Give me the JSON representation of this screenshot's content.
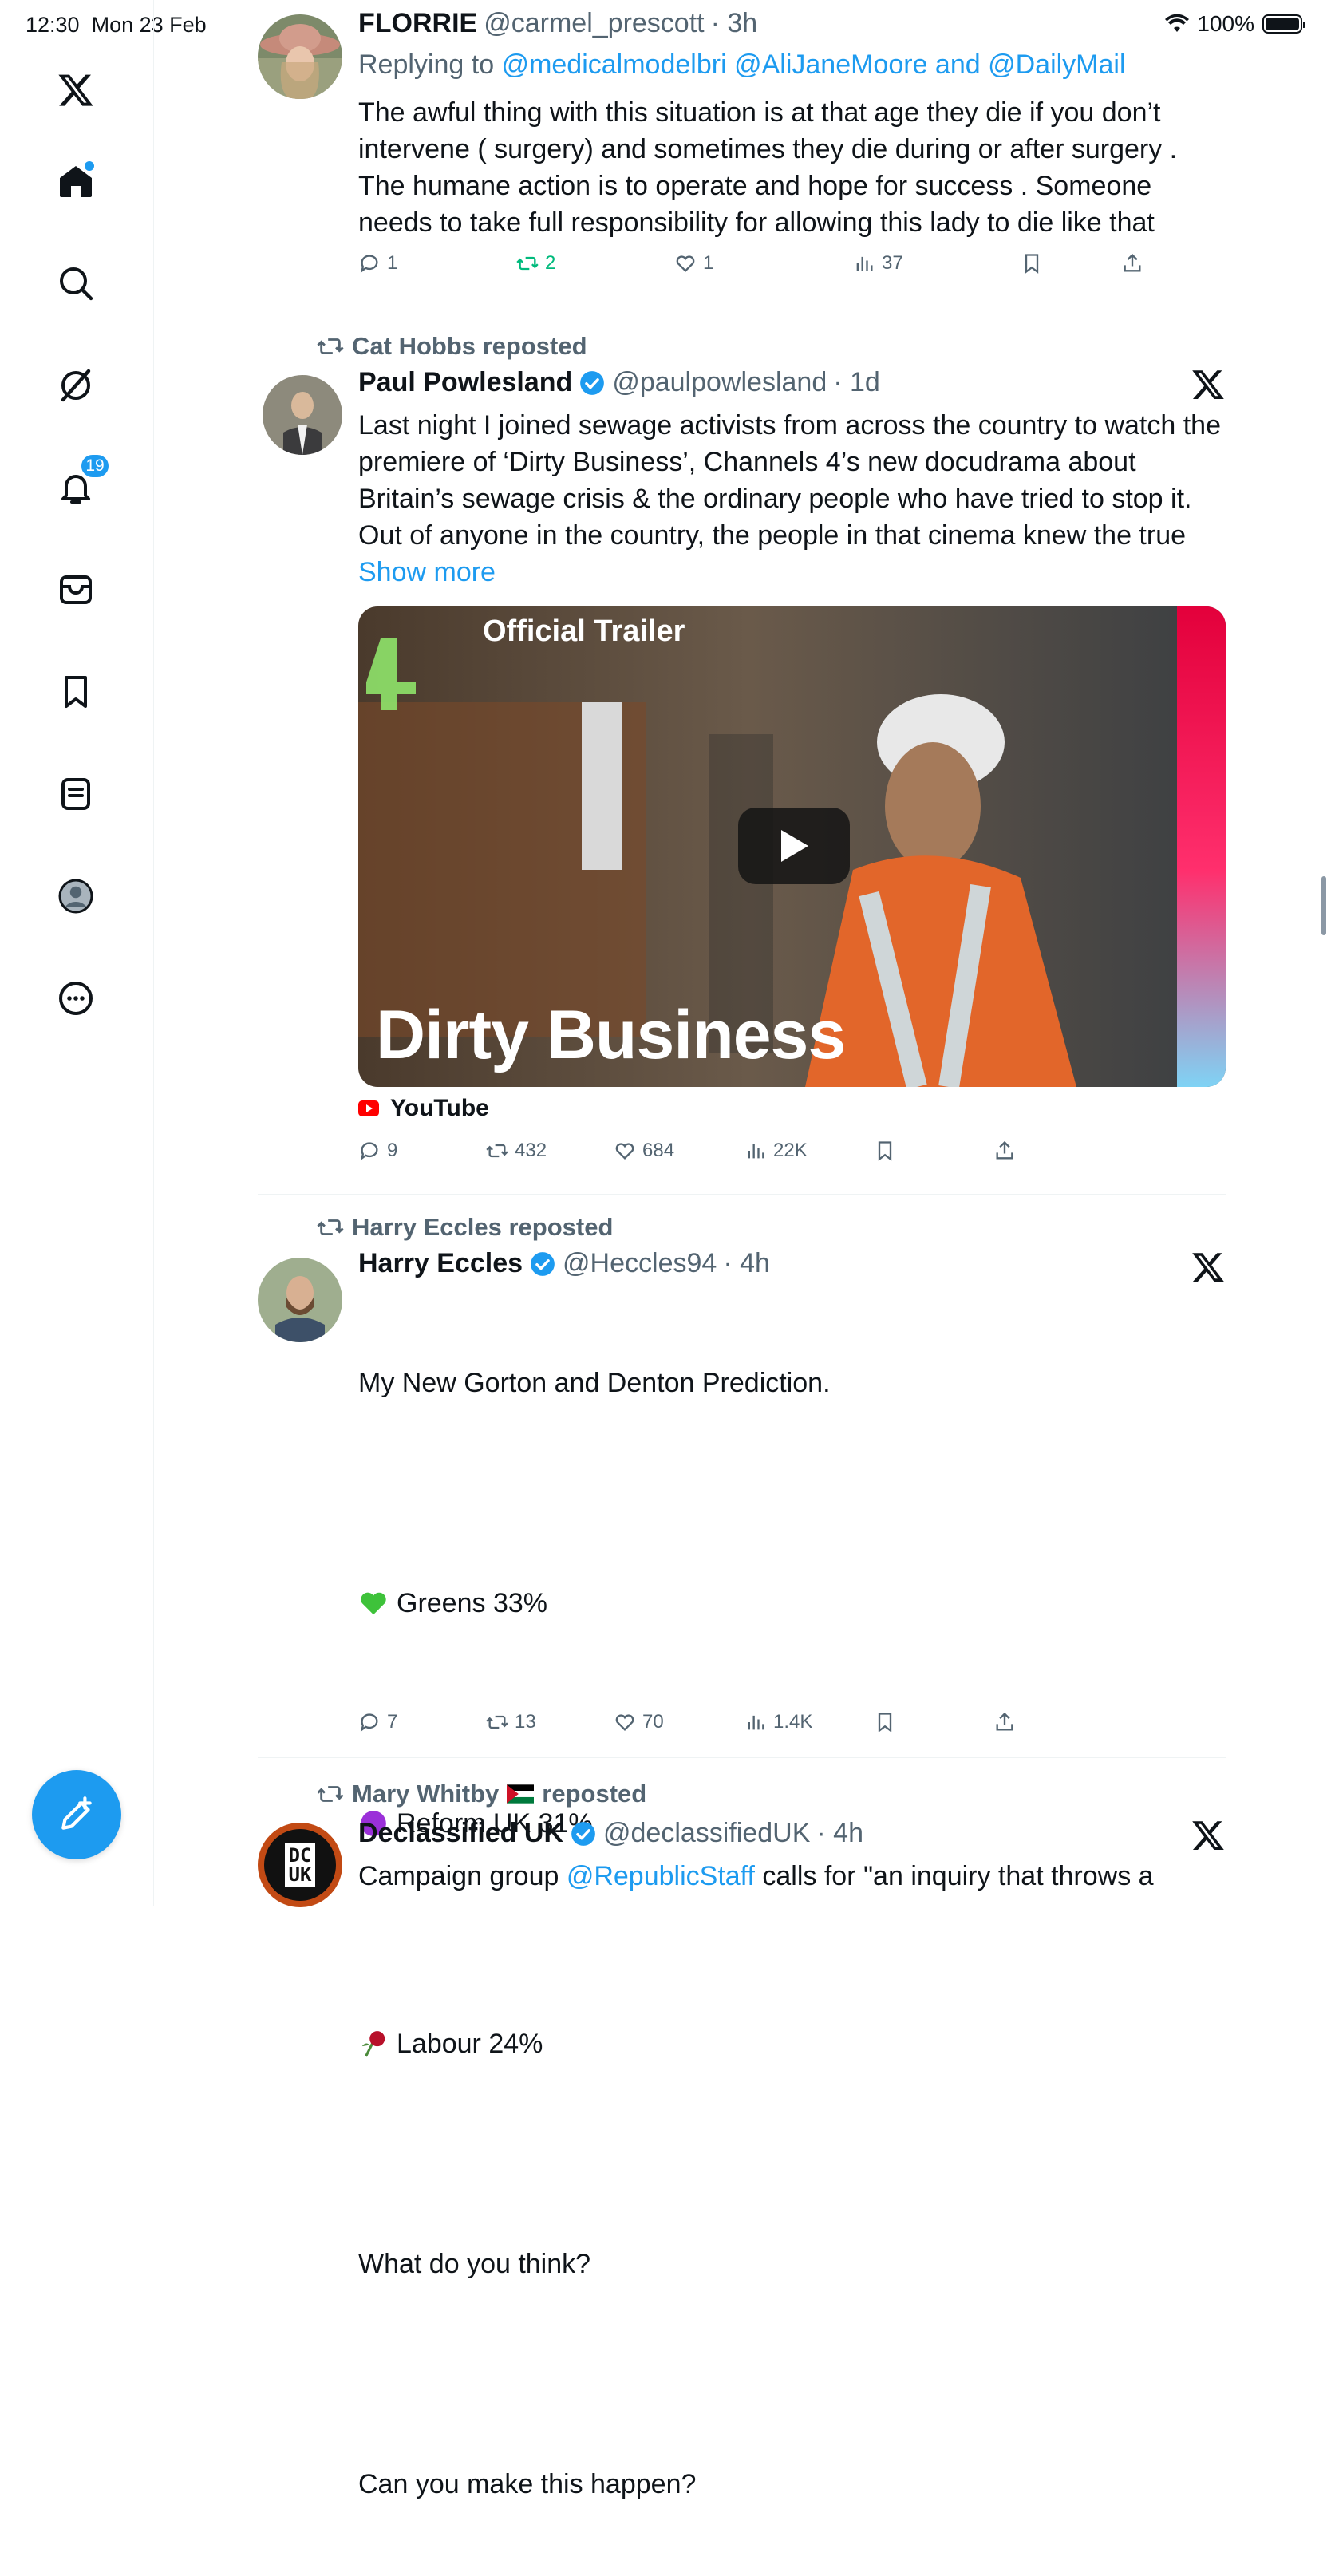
{
  "status_bar": {
    "time": "12:30",
    "date": "Mon 23 Feb",
    "battery": "100%"
  },
  "sidebar": {
    "items": [
      {
        "name": "x-logo"
      },
      {
        "name": "home"
      },
      {
        "name": "explore"
      },
      {
        "name": "grok"
      },
      {
        "name": "notifications",
        "badge": "19"
      },
      {
        "name": "messages"
      },
      {
        "name": "bookmarks"
      },
      {
        "name": "lists"
      },
      {
        "name": "profile"
      },
      {
        "name": "more"
      }
    ]
  },
  "tweets": [
    {
      "name": "FLORRIE",
      "handle": "@carmel_prescott",
      "time": "· 3h",
      "replying_to_prefix": "Replying to",
      "replying_to": "@medicalmodelbri @AliJaneMoore and @DailyMail",
      "text": "The awful thing with this situation is at that age they die if you don’t intervene ( surgery) and sometimes they die during or after surgery . The humane action is to operate and hope for success . Someone needs to take full responsibility for allowing this lady to die like that",
      "replies": "1",
      "reposts": "2",
      "likes": "1",
      "views": "37"
    },
    {
      "reposted_by": "Cat Hobbs reposted",
      "name": "Paul Powlesland",
      "handle": "@paulpowlesland",
      "time": "· 1d",
      "text": "Last night I joined sewage activists from across the country to watch the premiere of ‘Dirty Business’, Channels 4’s new docudrama about Britain’s sewage crisis & the ordinary people who have tried to stop it. Out of anyone in the country, the people in that cinema knew the true ",
      "show_more": "Show more",
      "media_badge": "Official Trailer",
      "media_title": "Dirty Business",
      "media_source": "YouTube",
      "replies": "9",
      "reposts": "432",
      "likes": "684",
      "views": "22K"
    },
    {
      "reposted_by": "Harry Eccles reposted",
      "name": "Harry Eccles",
      "handle": "@Heccles94",
      "time": "· 4h",
      "line1": "My New Gorton and Denton Prediction.",
      "poll": [
        "Greens 33%",
        "Reform UK 31%",
        "Labour 24%"
      ],
      "line2": "What do you think?",
      "line3": "Can you make this happen?",
      "replies": "7",
      "reposts": "13",
      "likes": "70",
      "views": "1.4K"
    },
    {
      "reposted_by": "Mary Whitby",
      "reposted_suffix": "reposted",
      "name": "Declassified UK",
      "handle": "@declassifiedUK",
      "time": "· 4h",
      "avatar_text_1": "DC",
      "avatar_text_2": "UK",
      "text_prefix": "Campaign group ",
      "text_link": "@RepublicStaff",
      "text_suffix": " calls for \"an inquiry that throws a"
    }
  ]
}
